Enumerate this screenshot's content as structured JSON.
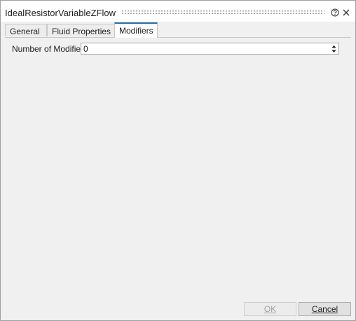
{
  "window": {
    "title": "IdealResistorVariableZFlow"
  },
  "icons": {
    "help": "help-icon",
    "close": "close-icon",
    "spin_up": "chevron-up-icon",
    "spin_down": "chevron-down-icon"
  },
  "tabs": [
    {
      "label": "General",
      "active": false
    },
    {
      "label": "Fluid Properties",
      "active": false
    },
    {
      "label": "Modifiers",
      "active": true
    }
  ],
  "modifiers": {
    "number_label": "Number of Modifiers",
    "number_value": "0"
  },
  "buttons": {
    "ok_label": "OK",
    "ok_enabled": false,
    "cancel_label": "Cancel"
  },
  "colors": {
    "active_tab_accent": "#1e6fb8",
    "dialog_background": "#f0f0f0"
  }
}
